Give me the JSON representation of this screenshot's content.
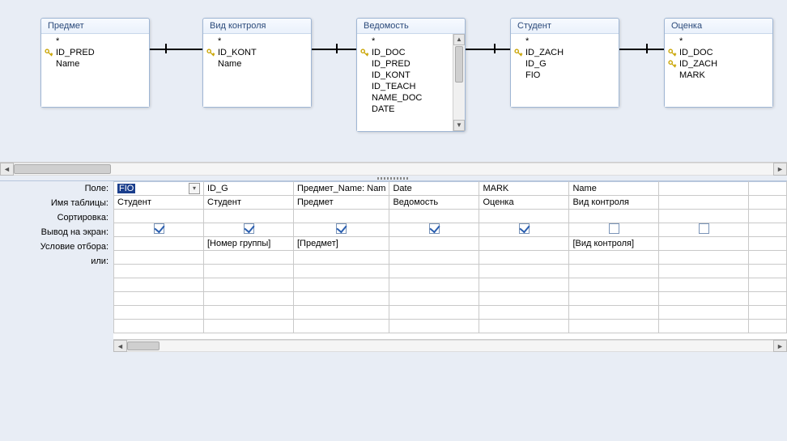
{
  "tables": [
    {
      "title": "Предмет",
      "fields": [
        "*",
        {
          "k": true,
          "n": "ID_PRED"
        },
        "Name"
      ]
    },
    {
      "title": "Вид контроля",
      "fields": [
        "*",
        {
          "k": true,
          "n": "ID_KONT"
        },
        "Name"
      ]
    },
    {
      "title": "Ведомость",
      "fields": [
        "*",
        {
          "k": true,
          "n": "ID_DOC"
        },
        "ID_PRED",
        "ID_KONT",
        "ID_TEACH",
        "NAME_DOC",
        "DATE"
      ],
      "scroll": true
    },
    {
      "title": "Студент",
      "fields": [
        "*",
        {
          "k": true,
          "n": "ID_ZACH"
        },
        "ID_G",
        "FIO"
      ]
    },
    {
      "title": "Оценка",
      "fields": [
        "*",
        {
          "k": true,
          "n": "ID_DOC"
        },
        {
          "k": true,
          "n": "ID_ZACH"
        },
        "MARK"
      ]
    }
  ],
  "grid": {
    "labels": {
      "field": "Поле:",
      "table": "Имя таблицы:",
      "sort": "Сортировка:",
      "show": "Вывод на экран:",
      "criteria": "Условие отбора:",
      "or": "или:"
    },
    "cols": [
      {
        "field": "FIO",
        "selected": true,
        "table": "Студент",
        "show": true,
        "criteria": ""
      },
      {
        "field": "ID_G",
        "table": "Студент",
        "show": true,
        "criteria": "[Номер группы]"
      },
      {
        "field": "Предмет_Name: Nam",
        "table": "Предмет",
        "show": true,
        "criteria": "[Предмет]"
      },
      {
        "field": "Date",
        "table": "Ведомость",
        "show": true,
        "criteria": ""
      },
      {
        "field": "MARK",
        "table": "Оценка",
        "show": true,
        "criteria": ""
      },
      {
        "field": "Name",
        "table": "Вид контроля",
        "show": false,
        "criteria": "[Вид контроля]"
      },
      {
        "field": "",
        "table": "",
        "show": false,
        "criteria": ""
      }
    ]
  }
}
